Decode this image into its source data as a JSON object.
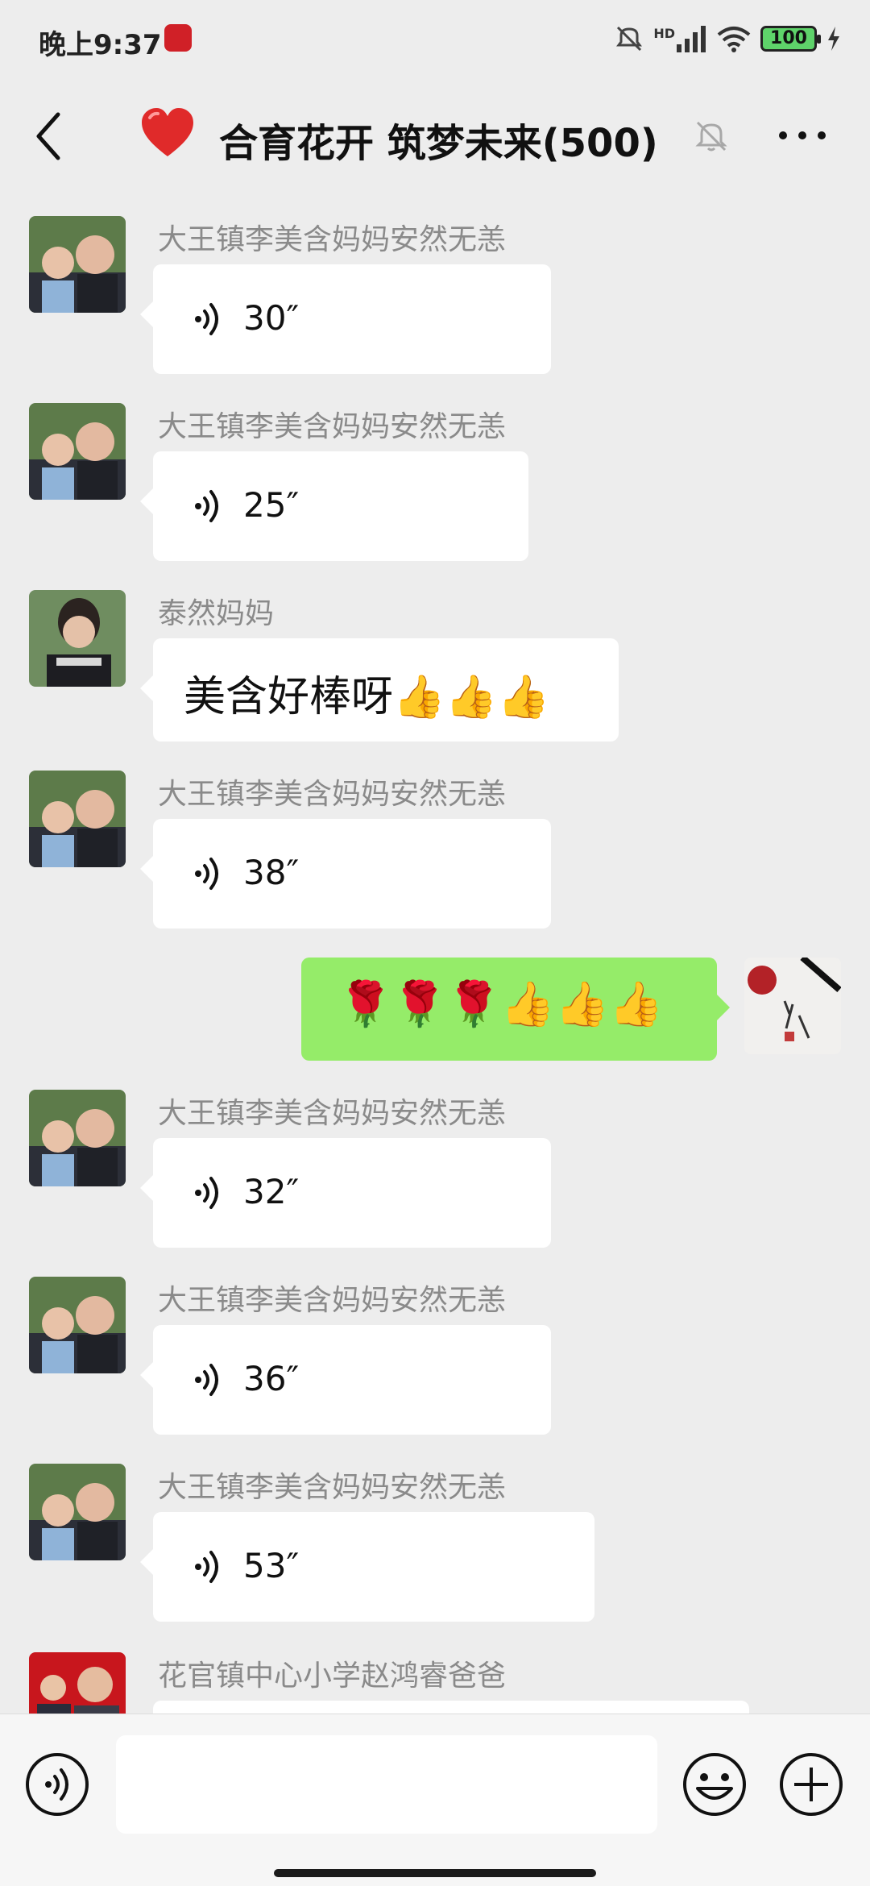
{
  "status_bar": {
    "time": "晚上9:37",
    "network": "HD",
    "battery": "100"
  },
  "header": {
    "title": "合育花开 筑梦未来(500)",
    "icons": [
      "back-icon",
      "heart-emoji",
      "mute-bell-icon",
      "more-icon"
    ]
  },
  "messages": [
    {
      "sender": "大王镇李美含妈妈安然无恙",
      "type": "voice",
      "duration": "30″"
    },
    {
      "sender": "大王镇李美含妈妈安然无恙",
      "type": "voice",
      "duration": "25″"
    },
    {
      "sender": "泰然妈妈",
      "type": "text",
      "text": "美含好棒呀👍👍👍"
    },
    {
      "sender": "大王镇李美含妈妈安然无恙",
      "type": "voice",
      "duration": "38″"
    },
    {
      "sender": "",
      "type": "mine-text",
      "text": "🌹🌹🌹👍👍👍"
    },
    {
      "sender": "大王镇李美含妈妈安然无恙",
      "type": "voice",
      "duration": "32″"
    },
    {
      "sender": "大王镇李美含妈妈安然无恙",
      "type": "voice",
      "duration": "36″"
    },
    {
      "sender": "大王镇李美含妈妈安然无恙",
      "type": "voice",
      "duration": "53″"
    },
    {
      "sender": "花官镇中心小学赵鸿睿爸爸",
      "type": "partial"
    }
  ],
  "input_bar": {
    "placeholder": "",
    "icons": [
      "voice-toggle-icon",
      "emoji-icon",
      "plus-icon"
    ]
  },
  "colors": {
    "background": "#ededed",
    "bubble_other": "#ffffff",
    "bubble_mine": "#95ec69",
    "sender_name": "#8a8a8a"
  }
}
